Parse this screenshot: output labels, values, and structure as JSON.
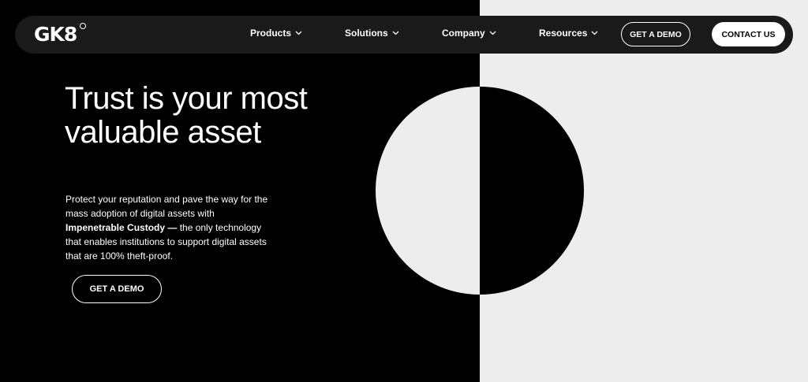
{
  "colors": {
    "left_background": "#000000",
    "right_background": "#ededed",
    "navbar_background": "#1a1a1a",
    "text_light": "#ffffff",
    "text_dark": "#000000"
  },
  "brand": {
    "logo_text": "GK8"
  },
  "nav": {
    "items": [
      {
        "label": "Products",
        "icon": "chevron-down-icon"
      },
      {
        "label": "Solutions",
        "icon": "chevron-down-icon"
      },
      {
        "label": "Company",
        "icon": "chevron-down-icon"
      },
      {
        "label": "Resources",
        "icon": "chevron-down-icon"
      }
    ],
    "demo_button": "GET A DEMO",
    "contact_button": "CONTACT US"
  },
  "hero": {
    "title": "Trust is your most valuable asset",
    "body_intro": "Protect your reputation and pave the way for the mass adoption of digital assets with ",
    "body_bold": "Impenetrable Custody —",
    "body_rest": " the only technology that enables institutions to support digital assets that are 100% theft-proof.",
    "cta_label": "GET A DEMO"
  },
  "graphic": {
    "icon": "split-circle-graphic"
  }
}
